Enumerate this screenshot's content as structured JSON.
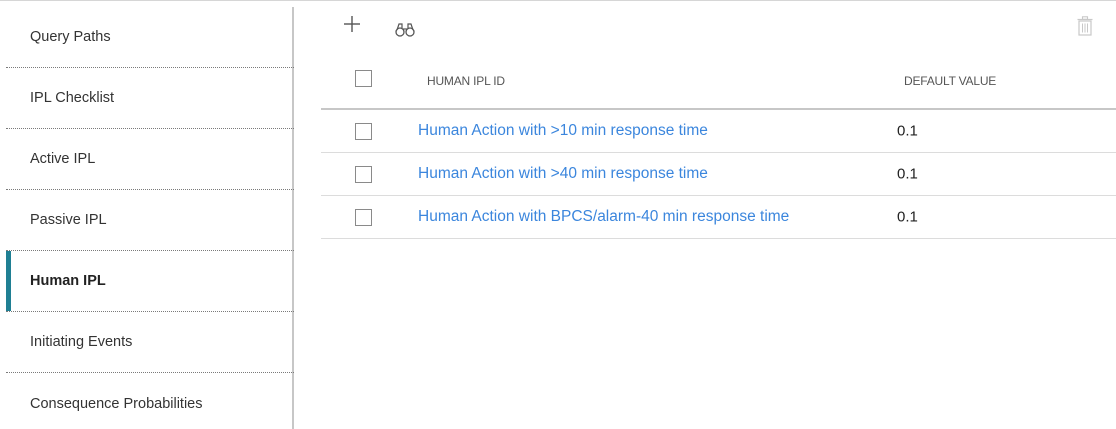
{
  "sidebar": {
    "items": [
      {
        "label": "Query Paths",
        "active": false
      },
      {
        "label": "IPL Checklist",
        "active": false
      },
      {
        "label": "Active IPL",
        "active": false
      },
      {
        "label": "Passive IPL",
        "active": false
      },
      {
        "label": "Human IPL",
        "active": true
      },
      {
        "label": "Initiating Events",
        "active": false
      },
      {
        "label": "Consequence Probabilities",
        "active": false
      }
    ],
    "active_indicator_color": "#1f7f93"
  },
  "toolbar": {
    "add_icon": "plus-icon",
    "search_icon": "binoculars-icon",
    "delete_icon": "trash-icon"
  },
  "table": {
    "columns": [
      "HUMAN IPL ID",
      "DEFAULT VALUE"
    ],
    "rows": [
      {
        "id": "Human Action with >10 min response time",
        "default_value": "0.1"
      },
      {
        "id": "Human Action with >40 min response time",
        "default_value": "0.1"
      },
      {
        "id": "Human Action with BPCS/alarm-40 min response time",
        "default_value": "0.1"
      }
    ],
    "link_color": "#3b86dd"
  }
}
